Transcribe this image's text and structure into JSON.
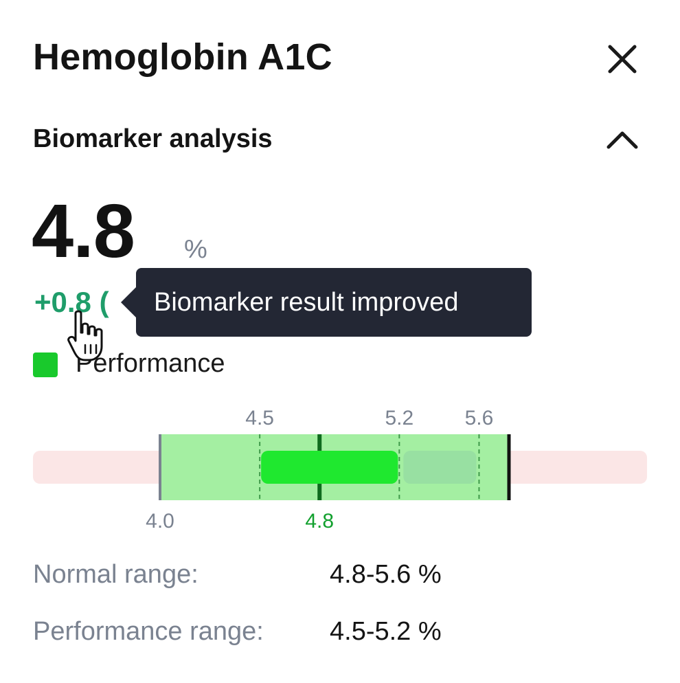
{
  "panel": {
    "title": "Hemoglobin A1C",
    "close_icon": "close-icon",
    "section_title": "Biomarker analysis",
    "collapse_icon": "chevron-up-icon"
  },
  "result": {
    "value": "4.8",
    "unit": "%",
    "delta": "+0.8 (",
    "tooltip": "Biomarker result improved"
  },
  "legend": {
    "label": "Performance",
    "color": "#19c92c"
  },
  "chart_data": {
    "type": "range-bar",
    "axis_min": 4.0,
    "axis_max": 5.75,
    "min_label": "4.0",
    "performance_range": [
      4.5,
      5.2
    ],
    "normal_range": [
      4.8,
      5.6
    ],
    "range_ticks": [
      "4.5",
      "5.2",
      "5.6"
    ],
    "value": 4.8,
    "value_label": "4.8",
    "colors": {
      "outside": "#fbe6e6",
      "band": "#a4efa2",
      "performance": "#1fe82f",
      "normal": "#98e0a2",
      "value_marker": "#0f6b1e",
      "dashed": "#3f9a4a"
    }
  },
  "ranges": {
    "normal_label": "Normal range:",
    "normal_value": "4.8-5.6 %",
    "performance_label": "Performance range:",
    "performance_value": "4.5-5.2 %"
  }
}
